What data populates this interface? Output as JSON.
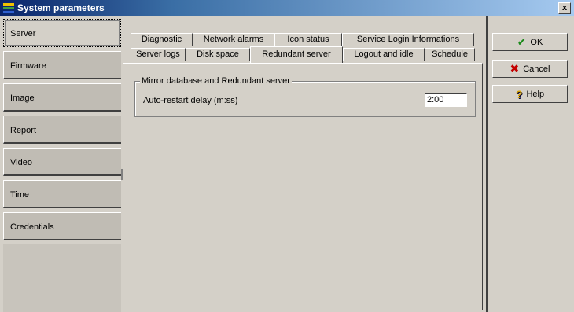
{
  "window": {
    "title": "System parameters",
    "close": "x"
  },
  "nav": {
    "items": [
      {
        "label": "Server"
      },
      {
        "label": "Firmware"
      },
      {
        "label": "Image"
      },
      {
        "label": "Report"
      },
      {
        "label": "Video"
      },
      {
        "label": "Time"
      },
      {
        "label": "Credentials"
      }
    ]
  },
  "tabs": {
    "row1": [
      "Diagnostic",
      "Network alarms",
      "Icon status",
      "Service Login Informations"
    ],
    "row2": [
      "Server logs",
      "Disk space",
      "Redundant server",
      "Logout and idle",
      "Schedule"
    ],
    "selected": "Redundant server"
  },
  "group": {
    "title": "Mirror database and Redundant server",
    "field_label": "Auto-restart delay (m:ss)",
    "field_value": "2:00"
  },
  "buttons": {
    "ok": "OK",
    "cancel": "Cancel",
    "help": "Help"
  },
  "icons": {
    "ok": "checkmark-icon",
    "cancel": "x-icon",
    "help": "question-icon"
  },
  "colors": {
    "titlebar_start": "#0a246a",
    "titlebar_end": "#a6caf0",
    "ok": "#1a8a1a",
    "cancel": "#c40000"
  }
}
